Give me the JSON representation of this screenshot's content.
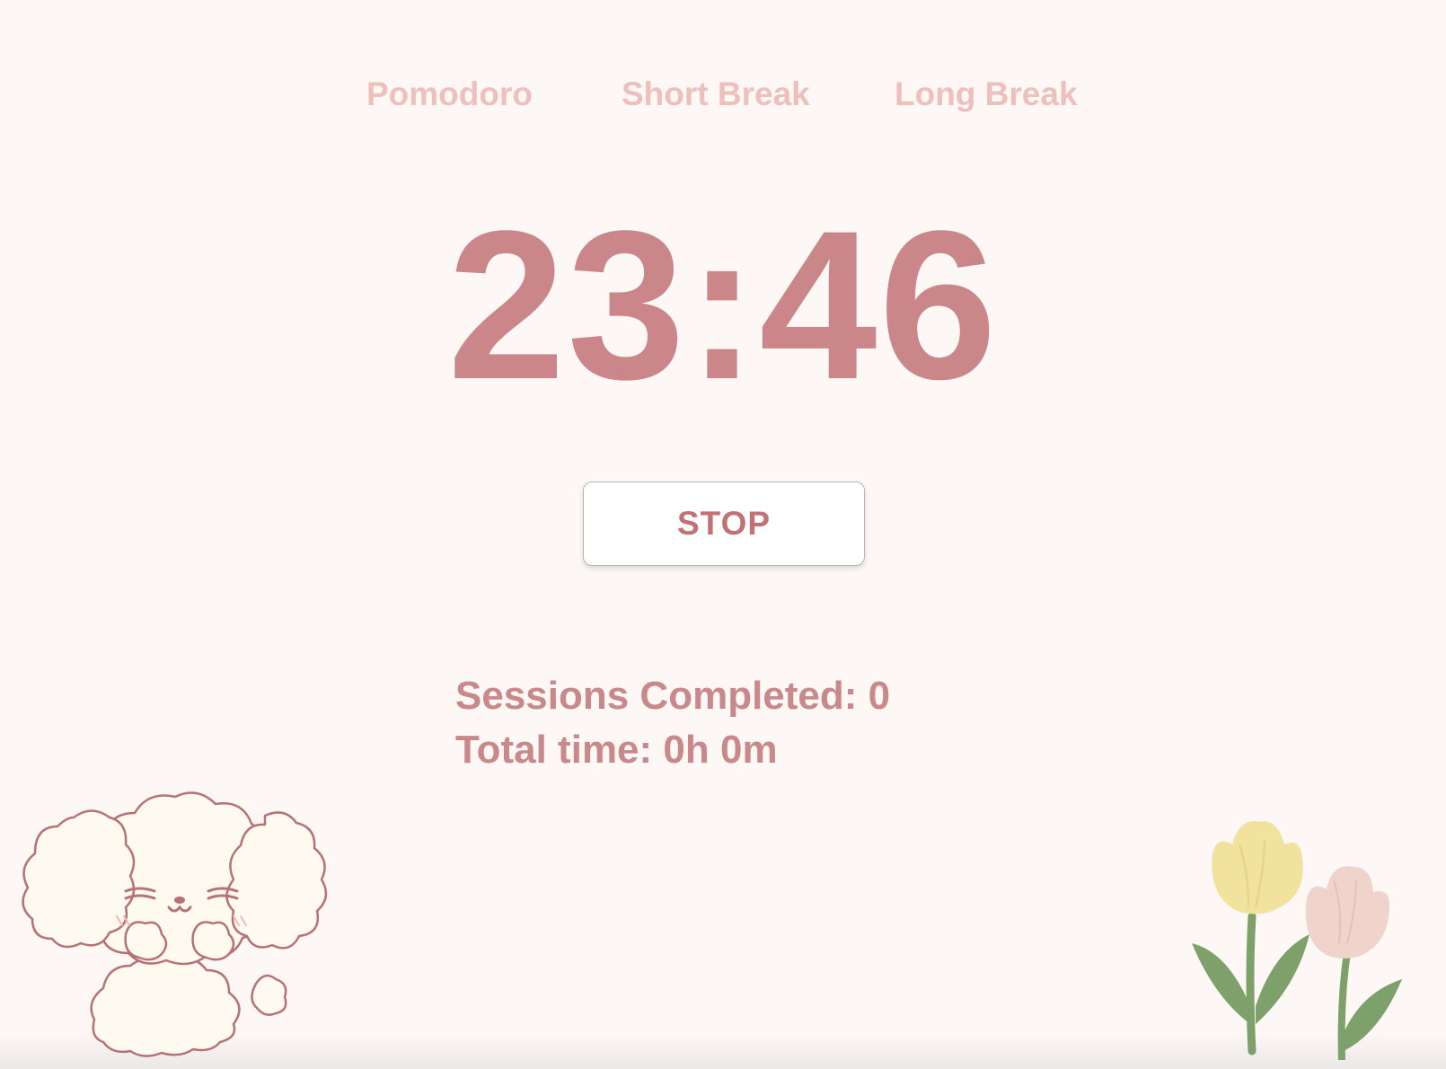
{
  "modes": {
    "pomodoro": "Pomodoro",
    "short_break": "Short Break",
    "long_break": "Long Break"
  },
  "timer": {
    "display": "23:46"
  },
  "controls": {
    "stop_label": "STOP"
  },
  "stats": {
    "sessions_label": "Sessions Completed:",
    "sessions_value": "0",
    "total_label": "Total time:",
    "total_value": "0h 0m"
  },
  "decorations": {
    "left": "puppy-illustration",
    "right": "tulips-illustration"
  },
  "colors": {
    "background": "#fdf7f6",
    "accent": "#ca8688",
    "tab_text": "#edc0bb",
    "button_text": "#c27275"
  }
}
